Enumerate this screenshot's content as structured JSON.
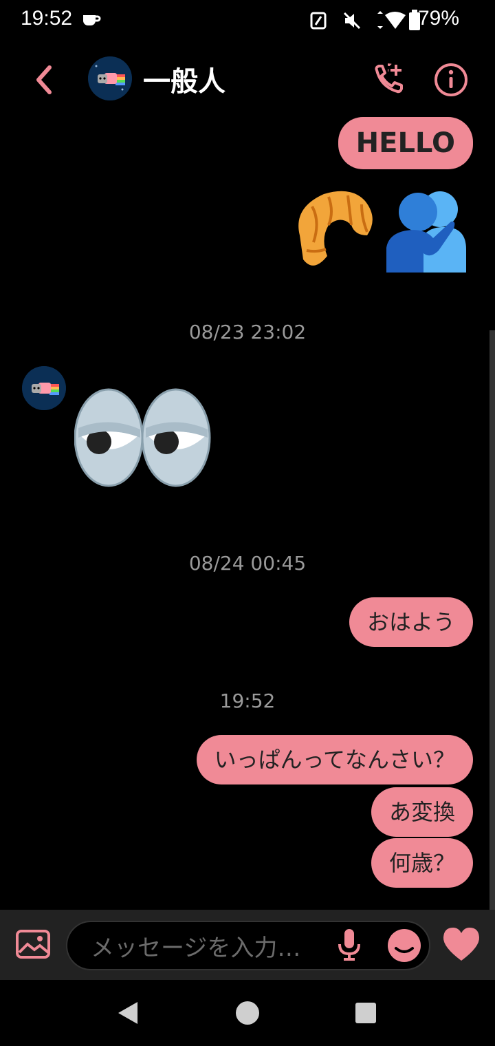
{
  "status": {
    "time": "19:52",
    "battery": "79%",
    "network": "4"
  },
  "header": {
    "contact_name": "一般人",
    "back_icon": "chevron-left-icon",
    "call_icon": "call-add-icon",
    "info_icon": "info-icon"
  },
  "messages": {
    "m1": "HELLO",
    "t1": "08/23 23:02",
    "t2": "08/24 00:45",
    "m2": "おはよう",
    "t3": "19:52",
    "m3": "いっぱんってなんさい？",
    "m4": "あ変換",
    "m5": "何歳？",
    "stickers": [
      "croissant",
      "people-hugging",
      "rolling-eyes"
    ]
  },
  "composer": {
    "placeholder": "メッセージを入力…"
  },
  "colors": {
    "accent": "#f08a96",
    "background": "#000000"
  }
}
